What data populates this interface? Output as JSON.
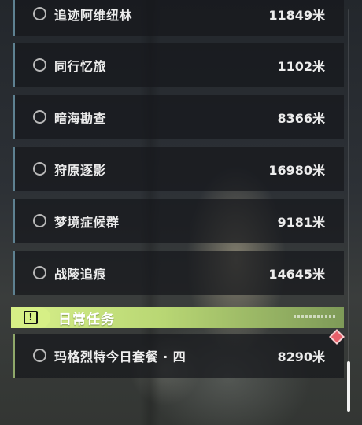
{
  "quests": [
    {
      "name": "追迹阿维纽林",
      "distance": "11849米"
    },
    {
      "name": "同行忆旅",
      "distance": "1102米"
    },
    {
      "name": "暗海勘查",
      "distance": "8366米"
    },
    {
      "name": "狩原逐影",
      "distance": "16980米"
    },
    {
      "name": "梦境症候群",
      "distance": "9181米"
    },
    {
      "name": "战陵追痕",
      "distance": "14645米"
    }
  ],
  "daily_section": {
    "title": "日常任务",
    "icon": "alert-icon",
    "quests": [
      {
        "name": "玛格烈特今日套餐 · 四",
        "distance": "8290米",
        "marker_icon": "diamond-marker-icon"
      }
    ]
  },
  "colors": {
    "main_quest_accent": "#5e8191",
    "daily_quest_accent": "#8fa86a",
    "daily_header": "#d6ef86",
    "track_marker": "#e8606a"
  }
}
